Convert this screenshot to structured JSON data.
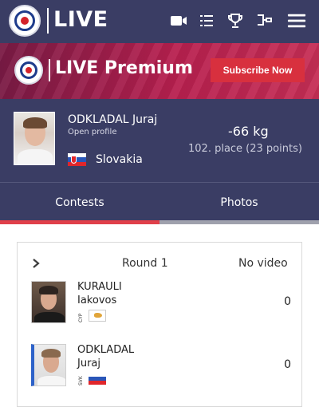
{
  "navbar": {
    "live_label": "LIVE",
    "icons": [
      "video-camera-icon",
      "list-icon",
      "trophy-icon",
      "bracket-icon",
      "hamburger-menu-icon"
    ]
  },
  "premium": {
    "title": "LIVE Premium",
    "subscribe_label": "Subscribe Now"
  },
  "athlete": {
    "name": "ODKLADAL Juraj",
    "profile_label": "Open profile",
    "country": "Slovakia",
    "weight": "-66 kg",
    "place": "102. place (23 points)"
  },
  "tabs": [
    {
      "label": "Contests",
      "active": true
    },
    {
      "label": "Photos",
      "active": false
    }
  ],
  "contest": {
    "round": "Round 1",
    "video": "No video",
    "contestants": [
      {
        "first": "KURAULI",
        "last": "Iakovos",
        "code": "CYP",
        "score": "0"
      },
      {
        "first": "ODKLADAL",
        "last": "Juraj",
        "code": "SVK",
        "score": "0"
      }
    ]
  },
  "colors": {
    "navbar": "#3a3d64",
    "active_tab_bar": "#e0404a",
    "subscribe_button": "#d8303e",
    "blue_marker": "#2d62c9"
  }
}
